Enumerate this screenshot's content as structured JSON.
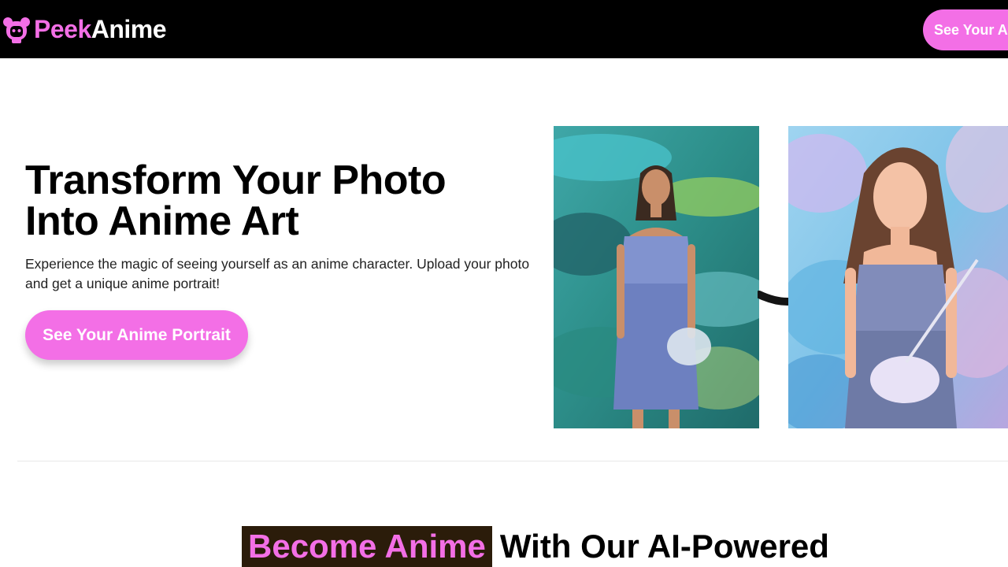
{
  "header": {
    "brand_primary": "Peek",
    "brand_secondary": "Anime",
    "logo_icon": "anime-girl-icon",
    "cta_label": "See Your Anime Portrait"
  },
  "hero": {
    "title": "Transform Your Photo Into Anime Art",
    "subtitle": "Experience the magic of seeing yourself as an anime character. Upload your photo and get a unique anime portrait!",
    "cta_label": "See Your Anime Portrait",
    "arrow_icon": "curved-arrow-right-icon"
  },
  "section": {
    "heading_highlight": "Become Anime",
    "heading_rest": "With Our AI-Powered"
  },
  "colors": {
    "accent": "#f36fe6",
    "header_bg": "#000000",
    "highlight_bg": "#2b1c0a"
  }
}
